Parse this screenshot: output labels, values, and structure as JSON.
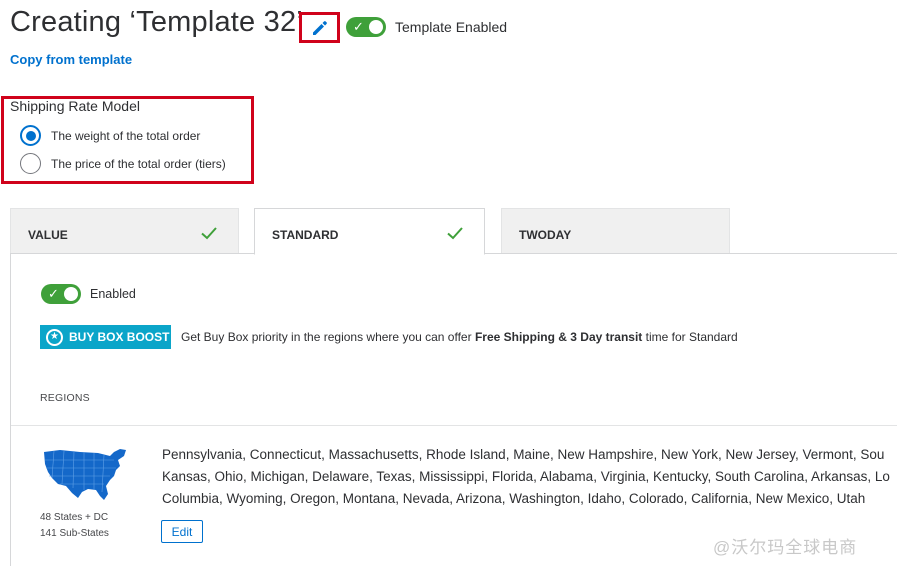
{
  "header": {
    "title": "Creating ‘Template 32’",
    "template_toggle_label": "Template Enabled",
    "copy_link": "Copy from template"
  },
  "rate_model": {
    "title": "Shipping Rate Model",
    "options": [
      {
        "label": "The weight of the total order",
        "selected": true
      },
      {
        "label": "The price of the total order (tiers)",
        "selected": false
      }
    ]
  },
  "tabs": [
    {
      "label": "VALUE",
      "checked": true,
      "active": false
    },
    {
      "label": "STANDARD",
      "checked": true,
      "active": true
    },
    {
      "label": "TWODAY",
      "checked": false,
      "active": false
    }
  ],
  "panel": {
    "enabled_label": "Enabled",
    "buybox": {
      "badge": "BUY BOX BOOST",
      "text_before": "Get Buy Box priority in the regions where you can offer ",
      "text_bold": "Free Shipping & 3 Day transit",
      "text_after": " time for Standard"
    },
    "regions_label": "REGIONS",
    "region": {
      "states_count": "48 States + DC",
      "substates_count": "141 Sub-States",
      "states_lines": [
        "Pennsylvania, Connecticut, Massachusetts, Rhode Island, Maine, New Hampshire, New York, New Jersey, Vermont, Sou",
        "Kansas, Ohio, Michigan, Delaware, Texas, Mississippi, Florida, Alabama, Virginia, Kentucky, South Carolina, Arkansas, Lo",
        "Columbia, Wyoming, Oregon, Montana, Nevada, Arizona, Washington, Idaho, Colorado, California, New Mexico, Utah"
      ],
      "edit_label": "Edit"
    }
  },
  "watermark": "@沃尔玛全球电商",
  "colors": {
    "accent_blue": "#0071ce",
    "toggle_green": "#3fa03a",
    "highlight_red": "#d0021b",
    "buybox_teal": "#0ba5c9"
  }
}
